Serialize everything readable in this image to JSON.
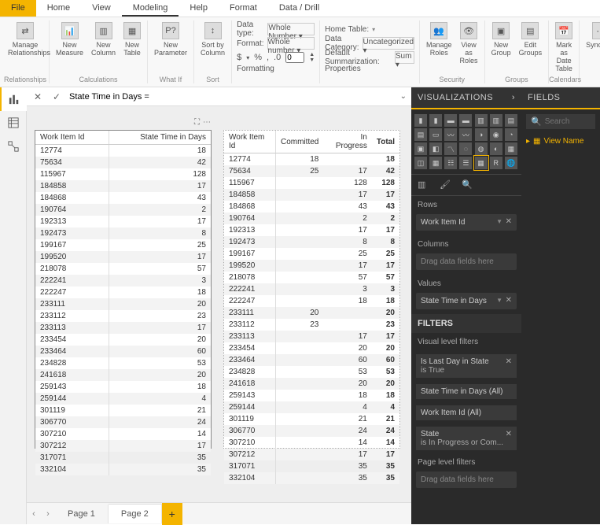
{
  "tabs": {
    "file": "File",
    "home": "Home",
    "view": "View",
    "modeling": "Modeling",
    "help": "Help",
    "format": "Format",
    "datadrill": "Data / Drill"
  },
  "ribbon": {
    "rel": {
      "manage": "Manage\nRelationships",
      "group": "Relationships"
    },
    "calc": {
      "measure": "New\nMeasure",
      "column": "New\nColumn",
      "table": "New\nTable",
      "group": "Calculations"
    },
    "whatif": {
      "param": "New\nParameter",
      "group": "What If"
    },
    "sort": {
      "sort": "Sort by\nColumn",
      "group": "Sort"
    },
    "formatting": {
      "datatype_label": "Data type:",
      "datatype_val": "Whole Number",
      "format_label": "Format:",
      "format_val": "Whole number",
      "decimals": "0",
      "group": "Formatting",
      "sym_dollar": "$",
      "sym_pct": "%",
      "sym_comma": ","
    },
    "props": {
      "hometable": "Home Table:",
      "datacat_label": "Data Category:",
      "datacat_val": "Uncategorized",
      "summ_label": "Default Summarization:",
      "summ_val": "Sum",
      "group": "Properties"
    },
    "security": {
      "manage": "Manage\nRoles",
      "view": "View as\nRoles",
      "group": "Security"
    },
    "groups": {
      "new": "New\nGroup",
      "edit": "Edit\nGroups",
      "group": "Groups"
    },
    "cal": {
      "mark": "Mark as\nDate Table",
      "group": "Calendars"
    },
    "syn": "Synonym"
  },
  "formula": "State Time in Days =",
  "table1": {
    "headers": [
      "Work Item Id",
      "State Time in Days"
    ],
    "rows": [
      [
        "12774",
        "18"
      ],
      [
        "75634",
        "42"
      ],
      [
        "115967",
        "128"
      ],
      [
        "184858",
        "17"
      ],
      [
        "184868",
        "43"
      ],
      [
        "190764",
        "2"
      ],
      [
        "192313",
        "17"
      ],
      [
        "192473",
        "8"
      ],
      [
        "199167",
        "25"
      ],
      [
        "199520",
        "17"
      ],
      [
        "218078",
        "57"
      ],
      [
        "222241",
        "3"
      ],
      [
        "222247",
        "18"
      ],
      [
        "233111",
        "20"
      ],
      [
        "233112",
        "23"
      ],
      [
        "233113",
        "17"
      ],
      [
        "233454",
        "20"
      ],
      [
        "233464",
        "60"
      ],
      [
        "234828",
        "53"
      ],
      [
        "241618",
        "20"
      ],
      [
        "259143",
        "18"
      ],
      [
        "259144",
        "4"
      ],
      [
        "301119",
        "21"
      ],
      [
        "306770",
        "24"
      ],
      [
        "307210",
        "14"
      ],
      [
        "307212",
        "17"
      ],
      [
        "317071",
        "35"
      ],
      [
        "332104",
        "35"
      ]
    ]
  },
  "table2": {
    "headers": [
      "Work Item Id",
      "Committed",
      "In Progress",
      "Total"
    ],
    "rows": [
      [
        "12774",
        "18",
        "",
        "18"
      ],
      [
        "75634",
        "25",
        "17",
        "42"
      ],
      [
        "115967",
        "",
        "128",
        "128"
      ],
      [
        "184858",
        "",
        "17",
        "17"
      ],
      [
        "184868",
        "",
        "43",
        "43"
      ],
      [
        "190764",
        "",
        "2",
        "2"
      ],
      [
        "192313",
        "",
        "17",
        "17"
      ],
      [
        "192473",
        "",
        "8",
        "8"
      ],
      [
        "199167",
        "",
        "25",
        "25"
      ],
      [
        "199520",
        "",
        "17",
        "17"
      ],
      [
        "218078",
        "",
        "57",
        "57"
      ],
      [
        "222241",
        "",
        "3",
        "3"
      ],
      [
        "222247",
        "",
        "18",
        "18"
      ],
      [
        "233111",
        "20",
        "",
        "20"
      ],
      [
        "233112",
        "23",
        "",
        "23"
      ],
      [
        "233113",
        "",
        "17",
        "17"
      ],
      [
        "233454",
        "",
        "20",
        "20"
      ],
      [
        "233464",
        "",
        "60",
        "60"
      ],
      [
        "234828",
        "",
        "53",
        "53"
      ],
      [
        "241618",
        "",
        "20",
        "20"
      ],
      [
        "259143",
        "",
        "18",
        "18"
      ],
      [
        "259144",
        "",
        "4",
        "4"
      ],
      [
        "301119",
        "",
        "21",
        "21"
      ],
      [
        "306770",
        "",
        "24",
        "24"
      ],
      [
        "307210",
        "",
        "14",
        "14"
      ],
      [
        "307212",
        "",
        "17",
        "17"
      ],
      [
        "317071",
        "",
        "35",
        "35"
      ],
      [
        "332104",
        "",
        "35",
        "35"
      ]
    ]
  },
  "pages": {
    "p1": "Page 1",
    "p2": "Page 2"
  },
  "vispane": {
    "title": "VISUALIZATIONS",
    "rows_label": "Rows",
    "rows_field": "Work Item Id",
    "cols_label": "Columns",
    "cols_placeholder": "Drag data fields here",
    "vals_label": "Values",
    "vals_field": "State Time in Days",
    "filters_title": "FILTERS",
    "vlevel": "Visual level filters",
    "f1_name": "Is Last Day in State",
    "f1_val": "is True",
    "f2": "State Time in Days  (All)",
    "f3": "Work Item Id  (All)",
    "f4_name": "State",
    "f4_val": "is In Progress or Com...",
    "plevel": "Page level filters",
    "p_placeholder": "Drag data fields here"
  },
  "fieldspane": {
    "title": "FIELDS",
    "search_ph": "Search",
    "view": "View Name"
  }
}
